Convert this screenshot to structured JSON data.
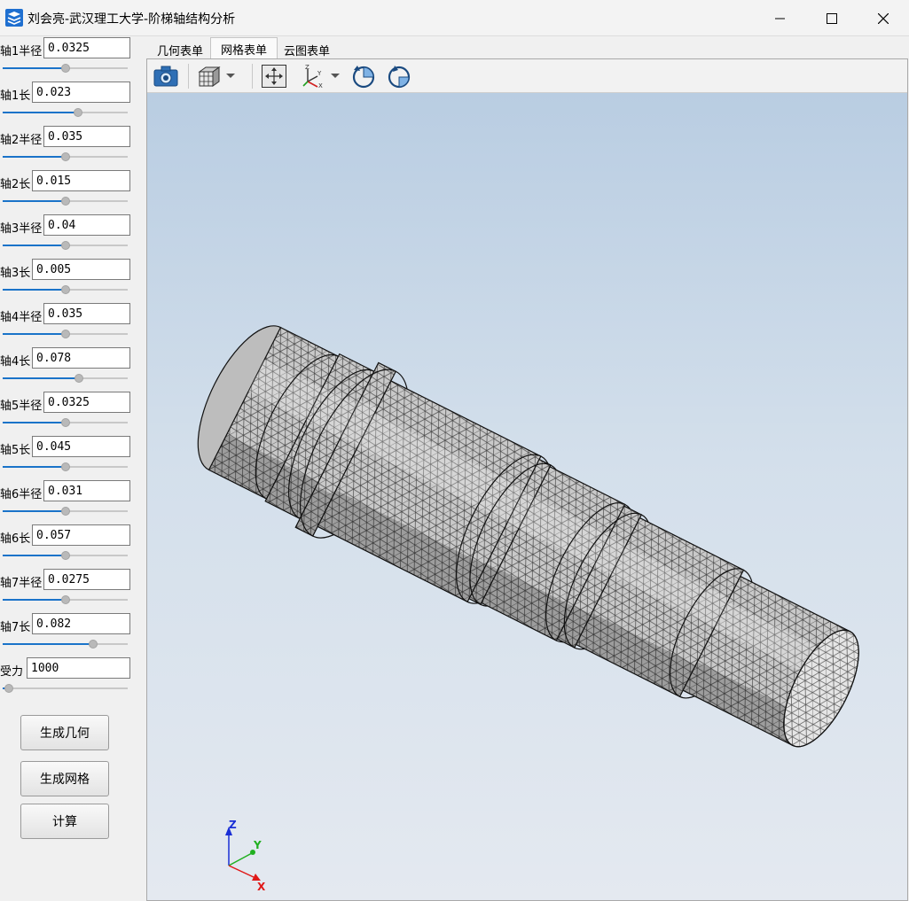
{
  "window": {
    "title": "刘会亮-武汉理工大学-阶梯轴结构分析"
  },
  "params": [
    {
      "label": "轴1半径",
      "value": "0.0325",
      "slider": 0.5
    },
    {
      "label": "轴1长",
      "value": "0.023",
      "slider": 0.6
    },
    {
      "label": "轴2半径",
      "value": "0.035",
      "slider": 0.5
    },
    {
      "label": "轴2长",
      "value": "0.015",
      "slider": 0.5
    },
    {
      "label": "轴3半径",
      "value": "0.04",
      "slider": 0.5
    },
    {
      "label": "轴3长",
      "value": "0.005",
      "slider": 0.5
    },
    {
      "label": "轴4半径",
      "value": "0.035",
      "slider": 0.5
    },
    {
      "label": "轴4长",
      "value": "0.078",
      "slider": 0.61
    },
    {
      "label": "轴5半径",
      "value": "0.0325",
      "slider": 0.5
    },
    {
      "label": "轴5长",
      "value": "0.045",
      "slider": 0.5
    },
    {
      "label": "轴6半径",
      "value": "0.031",
      "slider": 0.5
    },
    {
      "label": "轴6长",
      "value": "0.057",
      "slider": 0.5
    },
    {
      "label": "轴7半径",
      "value": "0.0275",
      "slider": 0.5
    },
    {
      "label": "轴7长",
      "value": "0.082",
      "slider": 0.72
    },
    {
      "label": "受力",
      "value": "1000",
      "slider": 0.05
    }
  ],
  "buttons": {
    "gen_geometry": "生成几何",
    "gen_mesh": "生成网格",
    "compute": "计算"
  },
  "tabs": [
    {
      "label": "几何表单",
      "active": false
    },
    {
      "label": "网格表单",
      "active": true
    },
    {
      "label": "云图表单",
      "active": false
    }
  ],
  "toolbar_icons": [
    "camera-icon",
    "cube-view-icon",
    "fit-all-icon",
    "axes-orientation-icon",
    "rotate-left-icon",
    "rotate-right-icon"
  ],
  "triad": {
    "x": "X",
    "y": "Y",
    "z": "Z"
  },
  "colors": {
    "accent": "#1a73c9",
    "slider_fill": "#1a73c9",
    "mesh": "#111111",
    "surface": "#c8c8c8"
  }
}
